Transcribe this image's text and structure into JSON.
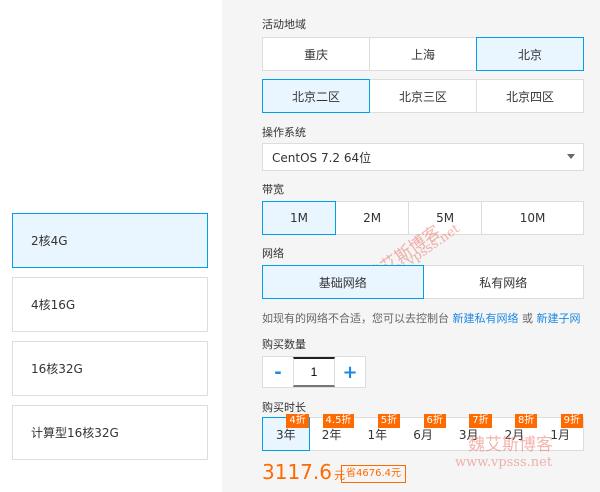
{
  "specs": [
    {
      "label": "2核4G",
      "active": true
    },
    {
      "label": "4核16G",
      "active": false
    },
    {
      "label": "16核32G",
      "active": false
    },
    {
      "label": "计算型16核32G",
      "active": false
    }
  ],
  "region": {
    "label": "活动地域",
    "cities": [
      "重庆",
      "上海",
      "北京"
    ],
    "zones": [
      "北京二区",
      "北京三区",
      "北京四区"
    ]
  },
  "os": {
    "label": "操作系统",
    "value": "CentOS 7.2 64位"
  },
  "bandwidth": {
    "label": "带宽",
    "options": [
      "1M",
      "2M",
      "5M",
      "10M"
    ]
  },
  "network": {
    "label": "网络",
    "options": [
      "基础网络",
      "私有网络"
    ],
    "hint_text": "如现有的网络不合适，您可以去控制台",
    "link1": "新建私有网络",
    "or": "或",
    "link2": "新建子网"
  },
  "quantity": {
    "label": "购买数量",
    "minus": "-",
    "value": "1",
    "plus": "+"
  },
  "duration": {
    "label": "购买时长",
    "options": [
      {
        "label": "3年",
        "discount": "4折"
      },
      {
        "label": "2年",
        "discount": "4.5折"
      },
      {
        "label": "1年",
        "discount": "5折"
      },
      {
        "label": "6月",
        "discount": "6折"
      },
      {
        "label": "3月",
        "discount": "7折"
      },
      {
        "label": "2月",
        "discount": "8折"
      },
      {
        "label": "1月",
        "discount": "9折"
      }
    ]
  },
  "price": {
    "amount": "3117.6",
    "unit": "元",
    "saving": "省4676.4元"
  },
  "watermark": {
    "cn": "魏艾斯博客",
    "url": "www.vpsss.net"
  },
  "colors": {
    "accent": "#00a0e9",
    "link": "#1e88e5",
    "price": "#ff6a00"
  }
}
